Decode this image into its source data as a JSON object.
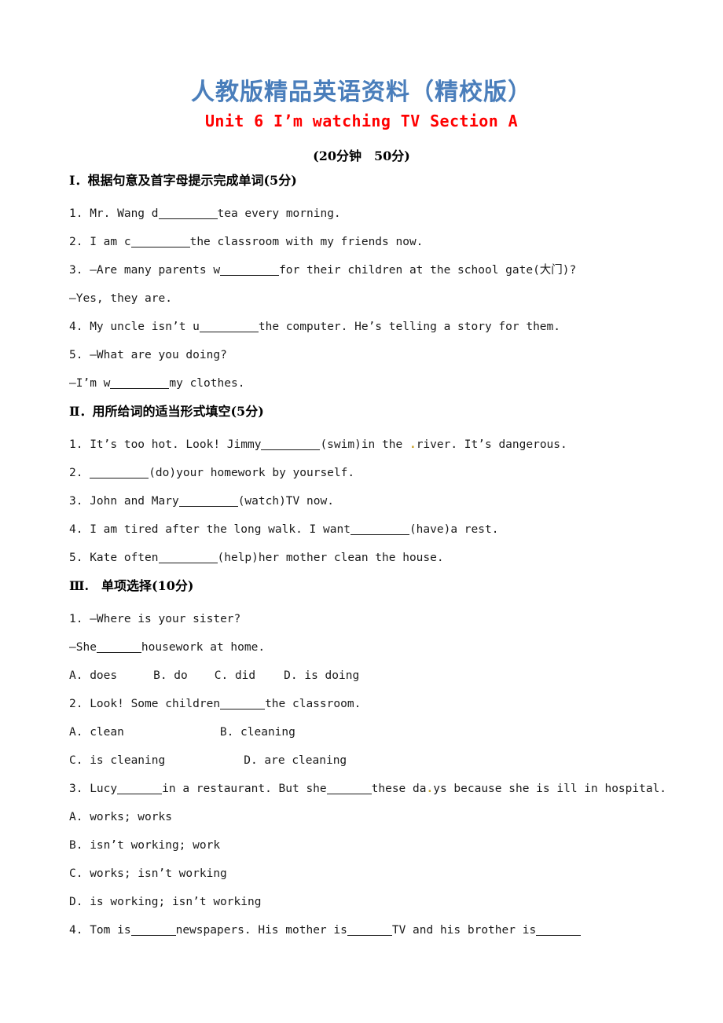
{
  "document": {
    "title_cn": "人教版精品英语资料（精校版）",
    "unit_title": "Unit 6 I’m watching TV Section A",
    "time_score": "(20分钟　50分)"
  },
  "sections": [
    {
      "id": "section-1",
      "heading": "Ⅰ．根据句意及首字母提示完成单词(5分)",
      "items": [
        {
          "number": "1.",
          "parts": [
            {
              "t": "text",
              "v": "Mr. Wang d"
            },
            {
              "t": "blank",
              "v": "long"
            },
            {
              "t": "text",
              "v": "tea every morning."
            }
          ]
        },
        {
          "number": "2.",
          "parts": [
            {
              "t": "text",
              "v": "I am c"
            },
            {
              "t": "blank",
              "v": "long"
            },
            {
              "t": "text",
              "v": "the classroom with my friends now."
            }
          ]
        },
        {
          "number": "3.",
          "parts": [
            {
              "t": "text",
              "v": "—Are many parents w"
            },
            {
              "t": "blank",
              "v": "long"
            },
            {
              "t": "text",
              "v": "for their children at the school gate(大门)?"
            }
          ]
        },
        {
          "number": "",
          "parts": [
            {
              "t": "text",
              "v": "—Yes, they are."
            }
          ]
        },
        {
          "number": "4.",
          "parts": [
            {
              "t": "text",
              "v": "My uncle isn’t u"
            },
            {
              "t": "blank",
              "v": "long"
            },
            {
              "t": "text",
              "v": "the computer. He’s telling a story for them."
            }
          ]
        },
        {
          "number": "5.",
          "parts": [
            {
              "t": "text",
              "v": "—What are you doing?"
            }
          ]
        },
        {
          "number": "",
          "parts": [
            {
              "t": "text",
              "v": "—I’m w"
            },
            {
              "t": "blank",
              "v": "long"
            },
            {
              "t": "text",
              "v": "my clothes."
            }
          ]
        }
      ]
    },
    {
      "id": "section-2",
      "heading": "Ⅱ．用所给词的适当形式填空(5分)",
      "items": [
        {
          "number": "1.",
          "parts": [
            {
              "t": "text",
              "v": "It’s too hot. Look! Jimmy"
            },
            {
              "t": "blank",
              "v": "long"
            },
            {
              "t": "text",
              "v": "(swim)in the "
            },
            {
              "t": "mark",
              "v": "."
            },
            {
              "t": "text",
              "v": "river. It’s dangerous."
            }
          ]
        },
        {
          "number": "2.",
          "parts": [
            {
              "t": "text",
              "v": " "
            },
            {
              "t": "blank",
              "v": "long"
            },
            {
              "t": "text",
              "v": "(do)your homework by yourself."
            }
          ]
        },
        {
          "number": "3.",
          "parts": [
            {
              "t": "text",
              "v": "John and Mary"
            },
            {
              "t": "blank",
              "v": "long"
            },
            {
              "t": "text",
              "v": "(watch)TV now."
            }
          ]
        },
        {
          "number": "4.",
          "parts": [
            {
              "t": "text",
              "v": "I am tired after the long walk. I want"
            },
            {
              "t": "blank",
              "v": "long"
            },
            {
              "t": "text",
              "v": "(have)a rest."
            }
          ]
        },
        {
          "number": "5.",
          "parts": [
            {
              "t": "text",
              "v": "Kate often"
            },
            {
              "t": "blank",
              "v": "long"
            },
            {
              "t": "text",
              "v": "(help)her mother clean the house."
            }
          ]
        }
      ]
    },
    {
      "id": "section-3",
      "heading": "Ⅲ.　单项选择(10分)",
      "items": [
        {
          "number": "1.",
          "parts": [
            {
              "t": "text",
              "v": "—Where is your sister?"
            }
          ]
        },
        {
          "number": "",
          "parts": [
            {
              "t": "text",
              "v": "—She"
            },
            {
              "t": "blank",
              "v": "short"
            },
            {
              "t": "text",
              "v": "housework at home."
            }
          ]
        },
        {
          "number": "",
          "options_inline": [
            "A. does",
            "B. do",
            "C. did",
            "D. is doing"
          ]
        },
        {
          "number": "2.",
          "parts": [
            {
              "t": "text",
              "v": "Look! Some children"
            },
            {
              "t": "blank",
              "v": "short"
            },
            {
              "t": "text",
              "v": "the classroom."
            }
          ]
        },
        {
          "number": "",
          "options_pair": [
            "A. clean",
            "B. cleaning"
          ]
        },
        {
          "number": "",
          "options_pair": [
            "C. is cleaning",
            "D. are cleaning"
          ]
        },
        {
          "number": "3.",
          "parts": [
            {
              "t": "text",
              "v": "Lucy"
            },
            {
              "t": "blank",
              "v": "short"
            },
            {
              "t": "text",
              "v": "in a restaurant. But she"
            },
            {
              "t": "blank",
              "v": "short"
            },
            {
              "t": "text",
              "v": "these da"
            },
            {
              "t": "mark",
              "v": "."
            },
            {
              "t": "text",
              "v": "ys because she is ill in hospital."
            }
          ]
        },
        {
          "number": "",
          "parts": [
            {
              "t": "text",
              "v": "A. works; works"
            }
          ]
        },
        {
          "number": "",
          "parts": [
            {
              "t": "text",
              "v": "B. isn’t working; work"
            }
          ]
        },
        {
          "number": "",
          "parts": [
            {
              "t": "text",
              "v": "C. works; isn’t working"
            }
          ]
        },
        {
          "number": "",
          "parts": [
            {
              "t": "text",
              "v": "D. is working; isn’t working"
            }
          ]
        },
        {
          "number": "4.",
          "parts": [
            {
              "t": "text",
              "v": "Tom is"
            },
            {
              "t": "blank",
              "v": "short"
            },
            {
              "t": "text",
              "v": "newspapers. His mother is"
            },
            {
              "t": "blank",
              "v": "short"
            },
            {
              "t": "text",
              "v": "TV and his brother is"
            },
            {
              "t": "blank",
              "v": "short"
            }
          ]
        }
      ]
    }
  ]
}
